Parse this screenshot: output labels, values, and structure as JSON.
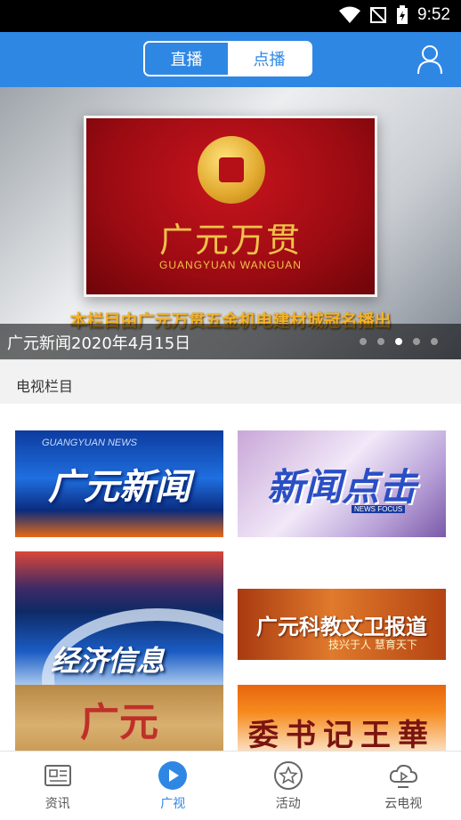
{
  "status_bar": {
    "time": "9:52"
  },
  "header": {
    "segments": [
      "直播",
      "点播"
    ],
    "selected_segment": "点播"
  },
  "banner": {
    "brand_cn": "广元万贯",
    "brand_en": "GUANGYUAN WANGUAN",
    "sponsor_text": "本栏目由广元万贯五金机电建材城冠名播出",
    "caption": "广元新闻2020年4月15日",
    "slide_count": 5,
    "active_slide_index": 2
  },
  "section": {
    "title": "电视栏目"
  },
  "programs": [
    {
      "label": "广元新闻",
      "sub": "GUANGYUAN NEWS"
    },
    {
      "label": "新闻点击",
      "sub": "NEWS FOCUS"
    },
    {
      "label": "经济信息"
    },
    {
      "label": "广元科教文卫报道",
      "sub": "技兴于人 慧育天下"
    },
    {
      "label": "广元"
    },
    {
      "label": "委书记王華"
    }
  ],
  "tabbar": {
    "items": [
      {
        "label": "资讯",
        "icon": "news-icon"
      },
      {
        "label": "广视",
        "icon": "play-icon"
      },
      {
        "label": "活动",
        "icon": "star-icon"
      },
      {
        "label": "云电视",
        "icon": "cloud-tv-icon"
      }
    ],
    "active": "广视"
  },
  "colors": {
    "primary": "#2f87e4",
    "status_bar": "#000000"
  }
}
